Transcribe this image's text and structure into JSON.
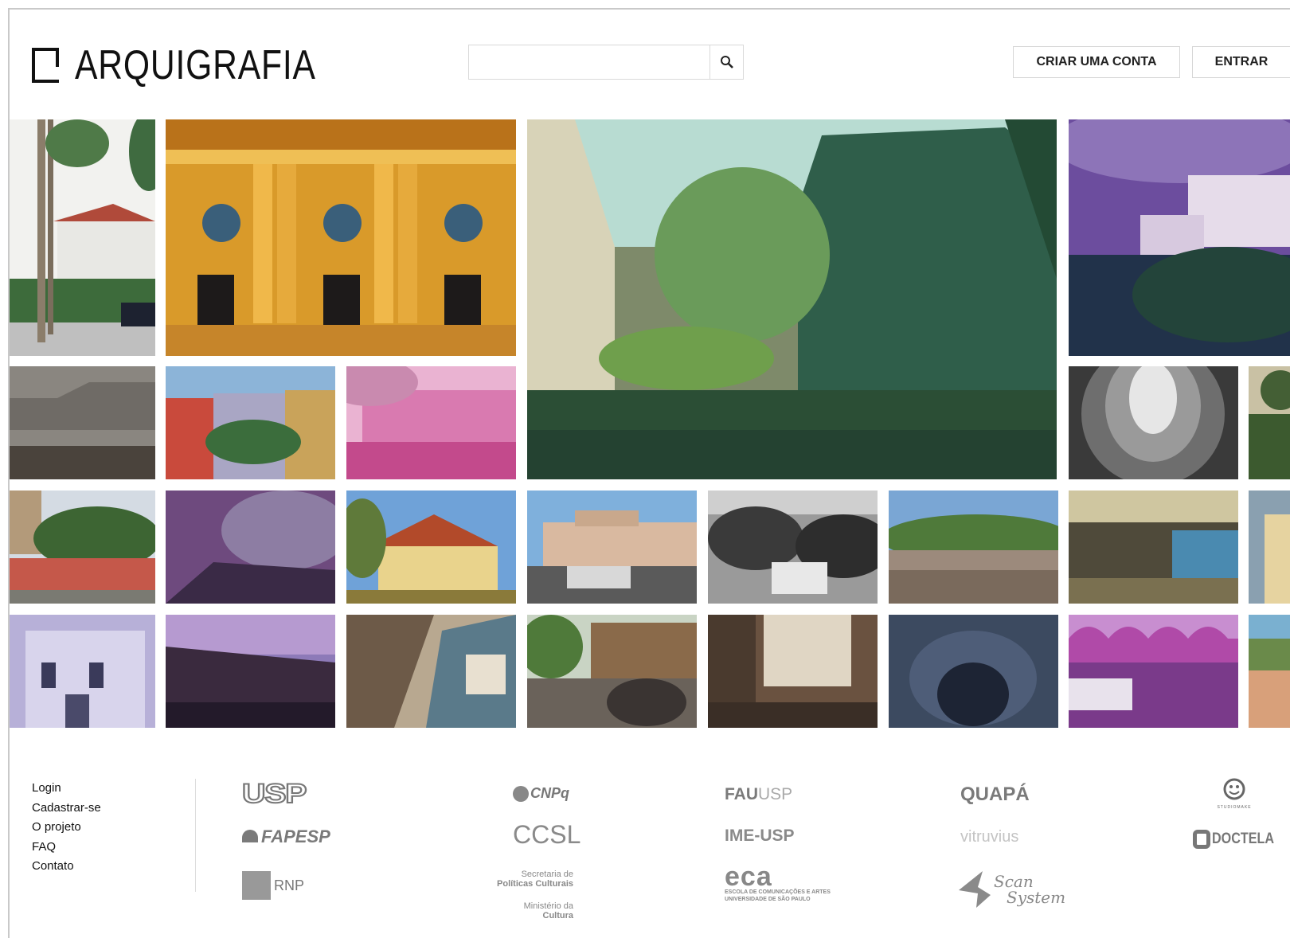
{
  "header": {
    "brand": "ARQUIGRAFIA",
    "search_placeholder": "",
    "create_account_label": "CRIAR UMA CONTA",
    "login_label": "ENTRAR"
  },
  "footer": {
    "links": [
      "Login",
      "Cadastrar-se",
      "O projeto",
      "FAQ",
      "Contato"
    ],
    "sponsors": {
      "usp": "USP",
      "fapesp": "FAPESP",
      "rnp": "RNP",
      "cnpq": "CNPq",
      "ccsl": "CCSL",
      "secretaria": "Secretaria de",
      "politicas": "Políticas Culturais",
      "ministerio": "Ministério da",
      "cultura": "Cultura",
      "fau_a": "FAU",
      "fau_b": "USP",
      "ime": "IME-USP",
      "eca": "eca",
      "eca_line1": "ESCOLA DE COMUNICAÇÕES E ARTES",
      "eca_line2": "UNIVERSIDADE DE SÃO PAULO",
      "quapa": "QUAPÁ",
      "vitruvius": "vitruvius",
      "scan": "Scan",
      "system": "System",
      "doctela": "DOCTELA",
      "smile": "STUDIOMAKE"
    }
  },
  "colors": {
    "brand_text": "#111111",
    "border": "#d6d6d6",
    "footer_gray": "#888888"
  }
}
